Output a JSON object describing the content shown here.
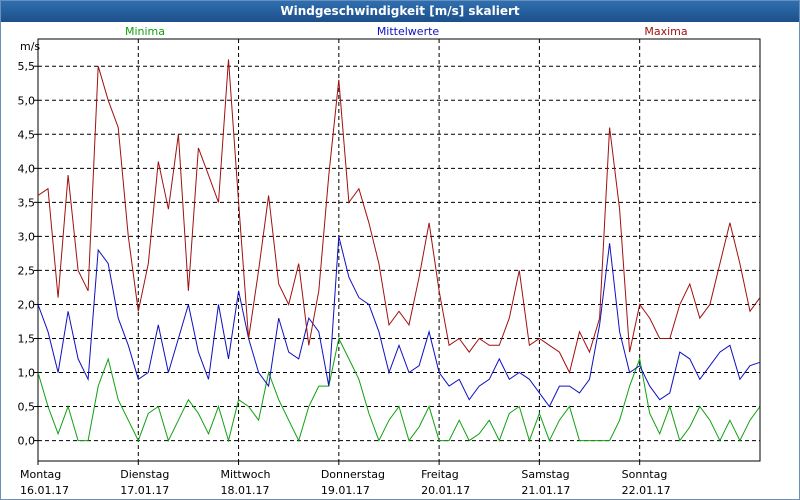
{
  "window": {
    "title": "Windgeschwindigkeit [m/s] skaliert"
  },
  "chart_data": {
    "type": "line",
    "title": "Windgeschwindigkeit [m/s] skaliert",
    "ylabel": "m/s",
    "ylim": [
      -0.3,
      5.9
    ],
    "yticks": [
      0.0,
      0.5,
      1.0,
      1.5,
      2.0,
      2.5,
      3.0,
      3.5,
      4.0,
      4.5,
      5.0,
      5.5
    ],
    "ytick_labels": [
      "0,0",
      "0,5",
      "1,0",
      "1,5",
      "2,0",
      "2,5",
      "3,0",
      "3,5",
      "4,0",
      "4,5",
      "5,0",
      "5,5"
    ],
    "xlim": [
      0,
      7.2
    ],
    "x_ticks": [
      {
        "day": "Montag",
        "date": "16.01.17"
      },
      {
        "day": "Dienstag",
        "date": "17.01.17"
      },
      {
        "day": "Mittwoch",
        "date": "18.01.17"
      },
      {
        "day": "Donnerstag",
        "date": "19.01.17"
      },
      {
        "day": "Freitag",
        "date": "20.01.17"
      },
      {
        "day": "Samstag",
        "date": "21.01.17"
      },
      {
        "day": "Sonntag",
        "date": "22.01.17"
      }
    ],
    "grid": true,
    "legend_position": "top",
    "series": [
      {
        "name": "Minima",
        "color": "#10a010",
        "x": [
          0,
          0.1,
          0.2,
          0.3,
          0.4,
          0.5,
          0.6,
          0.7,
          0.8,
          0.9,
          1.0,
          1.1,
          1.2,
          1.3,
          1.4,
          1.5,
          1.6,
          1.7,
          1.8,
          1.9,
          2.0,
          2.1,
          2.2,
          2.3,
          2.4,
          2.5,
          2.6,
          2.7,
          2.8,
          2.9,
          3.0,
          3.1,
          3.2,
          3.3,
          3.4,
          3.5,
          3.6,
          3.7,
          3.8,
          3.9,
          4.0,
          4.1,
          4.2,
          4.3,
          4.4,
          4.5,
          4.6,
          4.7,
          4.8,
          4.9,
          5.0,
          5.1,
          5.2,
          5.3,
          5.4,
          5.5,
          5.6,
          5.7,
          5.8,
          5.9,
          6.0,
          6.1,
          6.2,
          6.3,
          6.4,
          6.5,
          6.6,
          6.7,
          6.8,
          6.9,
          7.0,
          7.1,
          7.2
        ],
        "values": [
          1.0,
          0.5,
          0.1,
          0.5,
          0.0,
          0.0,
          0.8,
          1.2,
          0.6,
          0.3,
          0.0,
          0.4,
          0.5,
          0.0,
          0.3,
          0.6,
          0.4,
          0.1,
          0.5,
          0.0,
          0.6,
          0.5,
          0.3,
          1.0,
          0.6,
          0.3,
          0.0,
          0.5,
          0.8,
          0.8,
          1.5,
          1.2,
          0.9,
          0.4,
          0.0,
          0.3,
          0.5,
          0.0,
          0.2,
          0.5,
          0.0,
          0.0,
          0.3,
          0.0,
          0.1,
          0.3,
          0.0,
          0.4,
          0.5,
          0.0,
          0.4,
          0.0,
          0.3,
          0.5,
          0.0,
          0.0,
          0.0,
          0.0,
          0.3,
          0.8,
          1.2,
          0.4,
          0.1,
          0.5,
          0.0,
          0.2,
          0.5,
          0.3,
          0.0,
          0.3,
          0.0,
          0.3,
          0.5
        ]
      },
      {
        "name": "Mittelwerte",
        "color": "#1010c0",
        "x": [
          0,
          0.1,
          0.2,
          0.3,
          0.4,
          0.5,
          0.6,
          0.7,
          0.8,
          0.9,
          1.0,
          1.1,
          1.2,
          1.3,
          1.4,
          1.5,
          1.6,
          1.7,
          1.8,
          1.9,
          2.0,
          2.1,
          2.2,
          2.3,
          2.4,
          2.5,
          2.6,
          2.7,
          2.8,
          2.9,
          3.0,
          3.1,
          3.2,
          3.3,
          3.4,
          3.5,
          3.6,
          3.7,
          3.8,
          3.9,
          4.0,
          4.1,
          4.2,
          4.3,
          4.4,
          4.5,
          4.6,
          4.7,
          4.8,
          4.9,
          5.0,
          5.1,
          5.2,
          5.3,
          5.4,
          5.5,
          5.6,
          5.7,
          5.8,
          5.9,
          6.0,
          6.1,
          6.2,
          6.3,
          6.4,
          6.5,
          6.6,
          6.7,
          6.8,
          6.9,
          7.0,
          7.1,
          7.2
        ],
        "values": [
          2.0,
          1.6,
          1.0,
          1.9,
          1.2,
          0.9,
          2.8,
          2.6,
          1.8,
          1.4,
          0.9,
          1.0,
          1.7,
          1.0,
          1.5,
          2.0,
          1.3,
          0.9,
          2.0,
          1.2,
          2.2,
          1.5,
          1.0,
          0.8,
          1.8,
          1.3,
          1.2,
          1.8,
          1.6,
          0.8,
          3.0,
          2.4,
          2.1,
          2.0,
          1.6,
          1.0,
          1.4,
          1.0,
          1.1,
          1.6,
          1.0,
          0.8,
          0.9,
          0.6,
          0.8,
          0.9,
          1.2,
          0.9,
          1.0,
          0.9,
          0.7,
          0.5,
          0.8,
          0.8,
          0.7,
          0.9,
          1.7,
          2.9,
          1.6,
          1.0,
          1.1,
          0.8,
          0.6,
          0.7,
          1.3,
          1.2,
          0.9,
          1.1,
          1.3,
          1.4,
          0.9,
          1.1,
          1.15
        ]
      },
      {
        "name": "Maxima",
        "color": "#a01010",
        "x": [
          0,
          0.1,
          0.2,
          0.3,
          0.4,
          0.5,
          0.6,
          0.7,
          0.8,
          0.9,
          1.0,
          1.1,
          1.2,
          1.3,
          1.4,
          1.5,
          1.6,
          1.7,
          1.8,
          1.9,
          2.0,
          2.1,
          2.2,
          2.3,
          2.4,
          2.5,
          2.6,
          2.7,
          2.8,
          2.9,
          3.0,
          3.1,
          3.2,
          3.3,
          3.4,
          3.5,
          3.6,
          3.7,
          3.8,
          3.9,
          4.0,
          4.1,
          4.2,
          4.3,
          4.4,
          4.5,
          4.6,
          4.7,
          4.8,
          4.9,
          5.0,
          5.1,
          5.2,
          5.3,
          5.4,
          5.5,
          5.6,
          5.7,
          5.8,
          5.9,
          6.0,
          6.1,
          6.2,
          6.3,
          6.4,
          6.5,
          6.6,
          6.7,
          6.8,
          6.9,
          7.0,
          7.1,
          7.2
        ],
        "values": [
          3.6,
          3.7,
          2.1,
          3.9,
          2.5,
          2.2,
          5.5,
          5.0,
          4.6,
          3.0,
          1.9,
          2.6,
          4.1,
          3.4,
          4.5,
          2.2,
          4.3,
          3.9,
          3.5,
          5.6,
          3.5,
          1.5,
          2.5,
          3.6,
          2.3,
          2.0,
          2.6,
          1.4,
          2.2,
          3.9,
          5.3,
          3.5,
          3.7,
          3.2,
          2.6,
          1.7,
          1.9,
          1.7,
          2.4,
          3.2,
          2.2,
          1.4,
          1.5,
          1.3,
          1.5,
          1.4,
          1.4,
          1.8,
          2.5,
          1.4,
          1.5,
          1.4,
          1.3,
          1.0,
          1.6,
          1.3,
          1.8,
          4.6,
          3.4,
          1.3,
          2.0,
          1.8,
          1.5,
          1.5,
          2.0,
          2.3,
          1.8,
          2.0,
          2.6,
          3.2,
          2.6,
          1.9,
          2.1
        ]
      }
    ]
  }
}
